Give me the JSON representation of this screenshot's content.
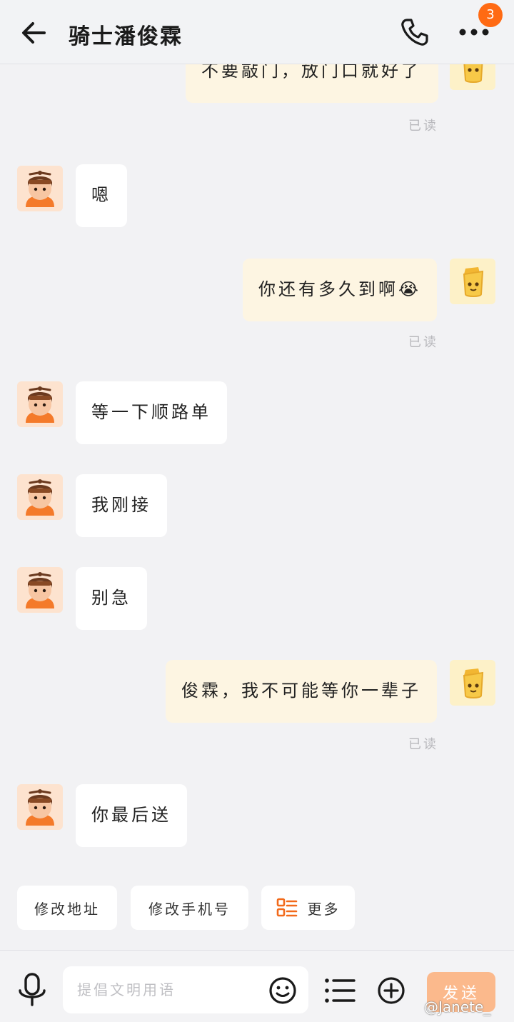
{
  "header": {
    "title": "骑士潘俊霖",
    "badge_count": "3"
  },
  "messages": [
    {
      "side": "out",
      "text": "不要敲门，放门口就好了",
      "read": "已读"
    },
    {
      "side": "in",
      "text": "嗯"
    },
    {
      "side": "out",
      "text": "你还有多久到啊😭",
      "read": "已读"
    },
    {
      "side": "in",
      "text": "等一下顺路单"
    },
    {
      "side": "in",
      "text": "我刚接"
    },
    {
      "side": "in",
      "text": "别急"
    },
    {
      "side": "out",
      "text": "俊霖，我不可能等你一辈子",
      "read": "已读"
    },
    {
      "side": "in",
      "text": "你最后送"
    }
  ],
  "quick_actions": {
    "modify_address": "修改地址",
    "modify_phone": "修改手机号",
    "more": "更多"
  },
  "input": {
    "placeholder": "提倡文明用语",
    "value": "",
    "send_label": "发送"
  },
  "watermark": "@Janete_",
  "colors": {
    "accent": "#ff6a13",
    "send_button": "#fbb98c",
    "outgoing_bubble": "#fdf5e2",
    "incoming_bubble": "#ffffff",
    "background": "#f2f2f4"
  },
  "icons": {
    "back": "arrow-left-icon",
    "phone": "phone-icon",
    "more": "more-dots-icon",
    "mic": "microphone-icon",
    "emoji": "smiley-icon",
    "list": "list-icon",
    "plus": "plus-circle-icon",
    "more_grid": "grid-list-icon",
    "rider_avatar": "rider-avatar",
    "user_avatar": "user-avatar"
  }
}
